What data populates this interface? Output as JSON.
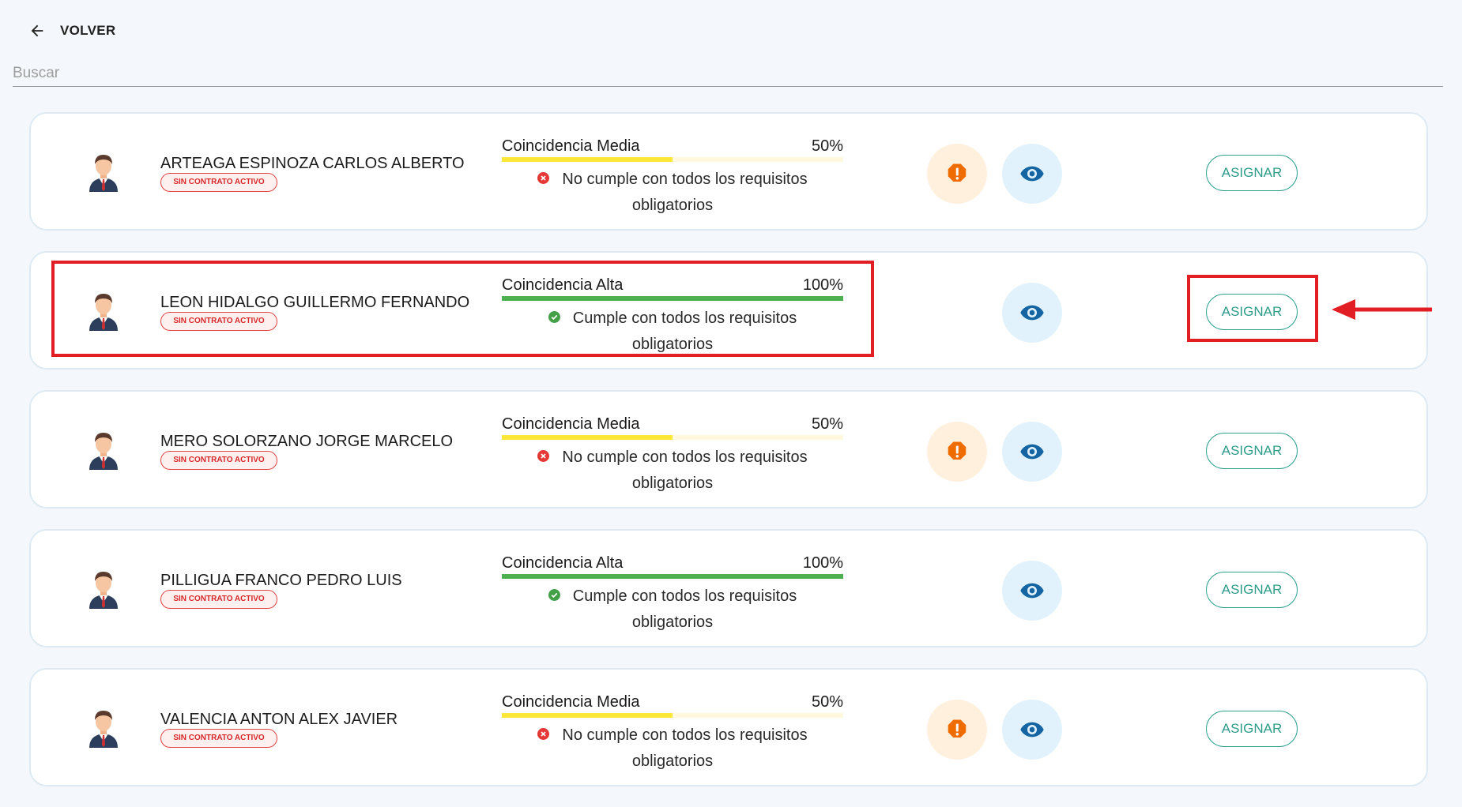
{
  "header": {
    "back_label": "VOLVER"
  },
  "search": {
    "placeholder": "Buscar",
    "value": ""
  },
  "colors": {
    "medium_bar": "#fce739",
    "high_bar": "#4caf50",
    "fail_icon": "#e53935",
    "pass_icon": "#43a047",
    "warning_icon": "#ef6c00",
    "eye_icon": "#1565a3",
    "annotation": "#e01e24"
  },
  "candidates": [
    {
      "name": "ARTEAGA ESPINOZA CARLOS ALBERTO",
      "badge": "SIN CONTRATO ACTIVO",
      "match_label": "Coincidencia Media",
      "match_percent": "50%",
      "match_value": 0.5,
      "requirement_line1": "No cumple con todos los requisitos",
      "requirement_line2": "obligatorios",
      "meets_requirements": false,
      "has_warning": true,
      "assign_label": "ASIGNAR"
    },
    {
      "name": "LEON HIDALGO GUILLERMO FERNANDO",
      "badge": "SIN CONTRATO ACTIVO",
      "match_label": "Coincidencia Alta",
      "match_percent": "100%",
      "match_value": 1.0,
      "requirement_line1": "Cumple con todos los requisitos",
      "requirement_line2": "obligatorios",
      "meets_requirements": true,
      "has_warning": false,
      "assign_label": "ASIGNAR"
    },
    {
      "name": "MERO SOLORZANO JORGE MARCELO",
      "badge": "SIN CONTRATO ACTIVO",
      "match_label": "Coincidencia Media",
      "match_percent": "50%",
      "match_value": 0.5,
      "requirement_line1": "No cumple con todos los requisitos",
      "requirement_line2": "obligatorios",
      "meets_requirements": false,
      "has_warning": true,
      "assign_label": "ASIGNAR"
    },
    {
      "name": "PILLIGUA FRANCO PEDRO LUIS",
      "badge": "SIN CONTRATO ACTIVO",
      "match_label": "Coincidencia Alta",
      "match_percent": "100%",
      "match_value": 1.0,
      "requirement_line1": "Cumple con todos los requisitos",
      "requirement_line2": "obligatorios",
      "meets_requirements": true,
      "has_warning": false,
      "assign_label": "ASIGNAR"
    },
    {
      "name": "VALENCIA ANTON ALEX JAVIER",
      "badge": "SIN CONTRATO ACTIVO",
      "match_label": "Coincidencia Media",
      "match_percent": "50%",
      "match_value": 0.5,
      "requirement_line1": "No cumple con todos los requisitos",
      "requirement_line2": "obligatorios",
      "meets_requirements": false,
      "has_warning": true,
      "assign_label": "ASIGNAR"
    }
  ]
}
